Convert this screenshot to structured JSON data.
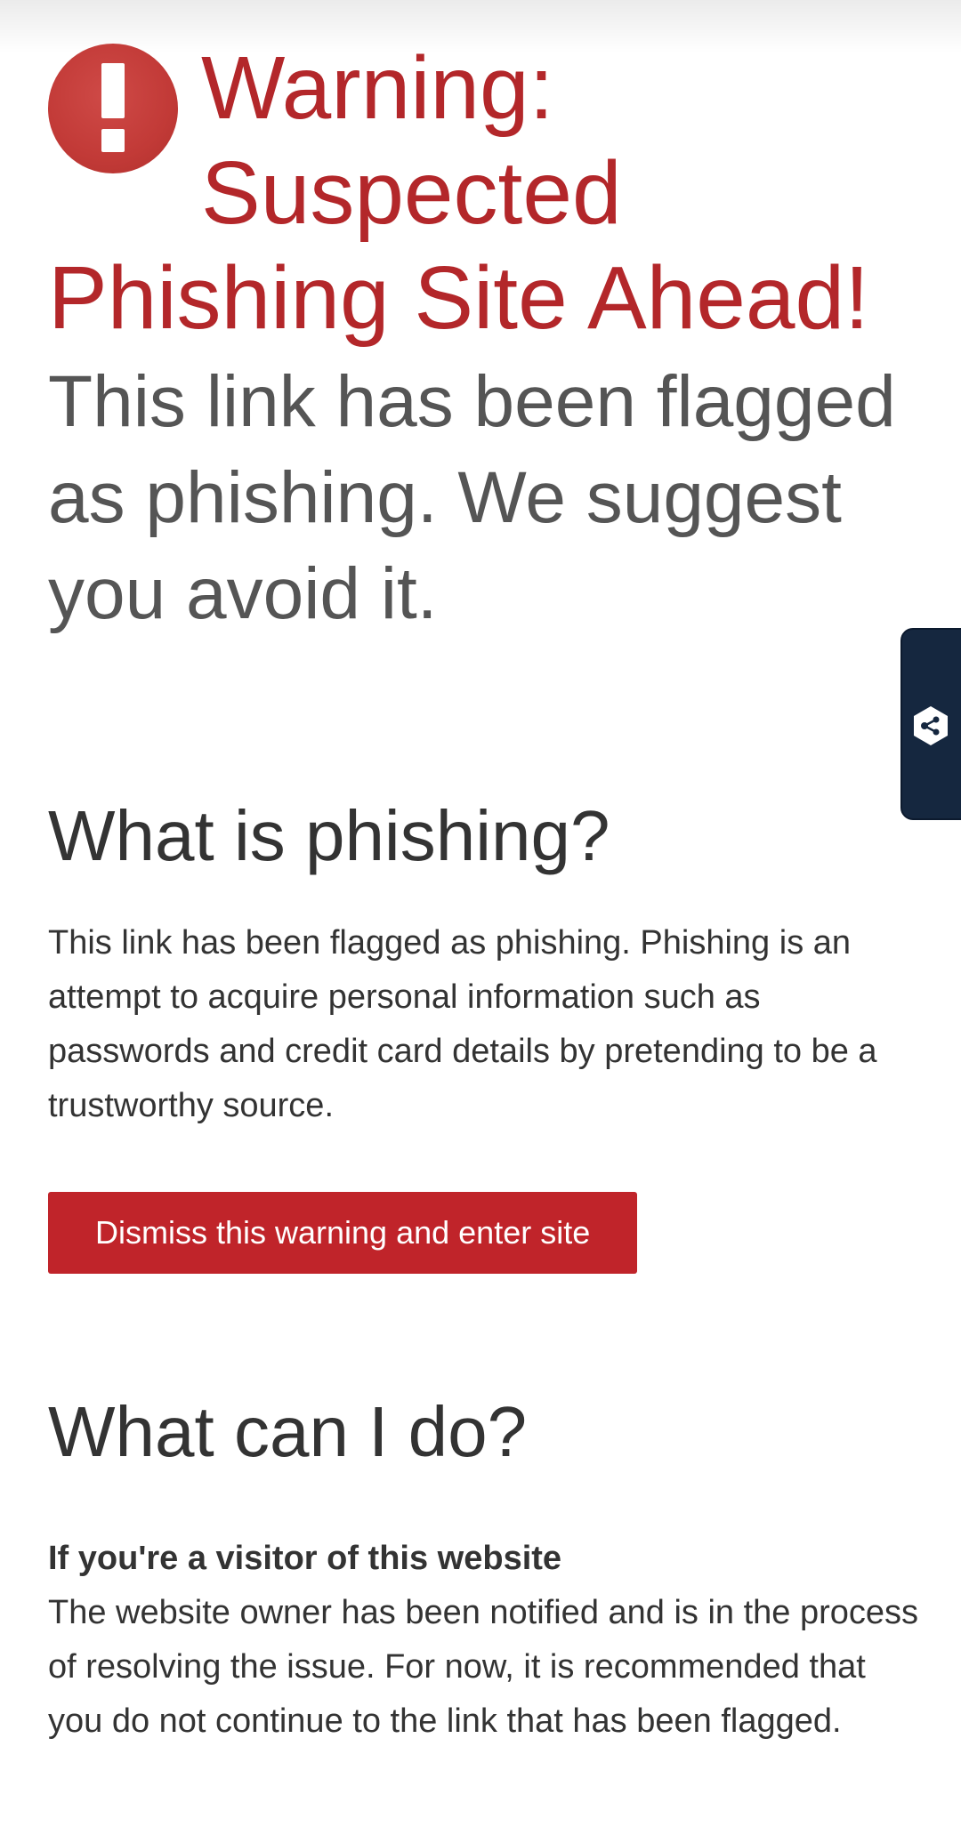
{
  "warning": {
    "title": "Warning: Suspected Phishing Site Ahead!",
    "subtitle": "This link has been flagged as phishing. We suggest you avoid it.",
    "icon": "exclamation-circle-icon",
    "color": "#b3272a"
  },
  "what_is_phishing": {
    "heading": "What is phishing?",
    "body": "This link has been flagged as phishing. Phishing is an attempt to acquire personal information such as passwords and credit card details by pretending to be a trustworthy source."
  },
  "dismiss_button": {
    "label": "Dismiss this warning and enter site",
    "color": "#c0242a"
  },
  "what_can_i_do": {
    "heading": "What can I do?",
    "visitor_heading": "If you're a visitor of this website",
    "visitor_body": "The website owner has been notified and is in the process of resolving the issue. For now, it is recommended that you do not continue to the link that has been flagged."
  },
  "side_tab": {
    "icon": "share-hexagon-icon",
    "color": "#15273f"
  }
}
